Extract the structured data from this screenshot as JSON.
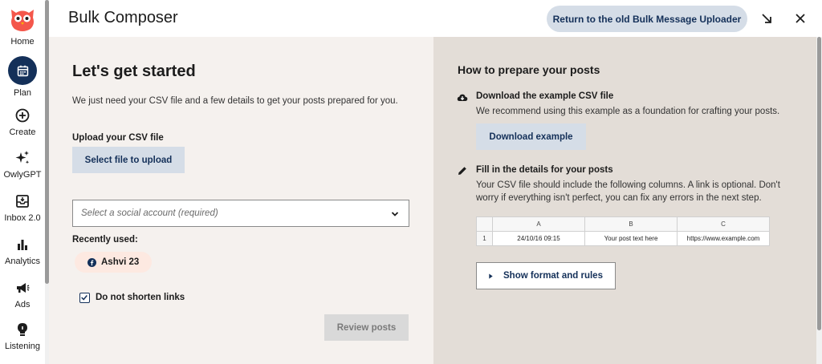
{
  "app": {
    "title": "Bulk Composer"
  },
  "header": {
    "return_label": "Return to the old Bulk Message Uploader"
  },
  "sidebar": {
    "items": [
      {
        "label": "Home",
        "icon": "owl-logo-icon"
      },
      {
        "label": "Plan",
        "icon": "calendar-icon"
      },
      {
        "label": "Create",
        "icon": "plus-circle-icon"
      },
      {
        "label": "OwlyGPT",
        "icon": "sparkles-icon"
      },
      {
        "label": "Inbox 2.0",
        "icon": "inbox-icon"
      },
      {
        "label": "Analytics",
        "icon": "bar-chart-icon"
      },
      {
        "label": "Ads",
        "icon": "megaphone-icon"
      },
      {
        "label": "Listening",
        "icon": "lightbulb-icon"
      }
    ]
  },
  "left": {
    "heading": "Let's get started",
    "intro": "We just need your CSV file and a few details to get your posts prepared for you.",
    "upload_label": "Upload your CSV file",
    "select_file_label": "Select file to upload",
    "account_placeholder": "Select a social account (required)",
    "recent_label": "Recently used:",
    "recent_account": "Ashvi 23",
    "shorten_label": "Do not shorten links",
    "shorten_checked": true,
    "review_label": "Review posts"
  },
  "right": {
    "heading": "How to prepare your posts",
    "step1_title": "Download the example CSV file",
    "step1_text": "We recommend using this example as a foundation for crafting your posts.",
    "download_label": "Download example",
    "step2_title": "Fill in the details for your posts",
    "step2_text": "Your CSV file should include the following columns. A link is optional. Don't worry if everything isn't perfect, you can fix any errors in the next step.",
    "csv": {
      "headers": [
        "A",
        "B",
        "C"
      ],
      "row_num": "1",
      "row": [
        "24/10/16 09:15",
        "Your post text here",
        "https://www.example.com"
      ]
    },
    "show_format_label": "Show format and rules"
  },
  "colors": {
    "navy": "#143059",
    "brand_red": "#f4574b",
    "left_bg": "#f5f1ee",
    "right_bg": "#e3ddd7",
    "button_bg": "#d5dde7",
    "chip_bg": "#fde9e1"
  }
}
